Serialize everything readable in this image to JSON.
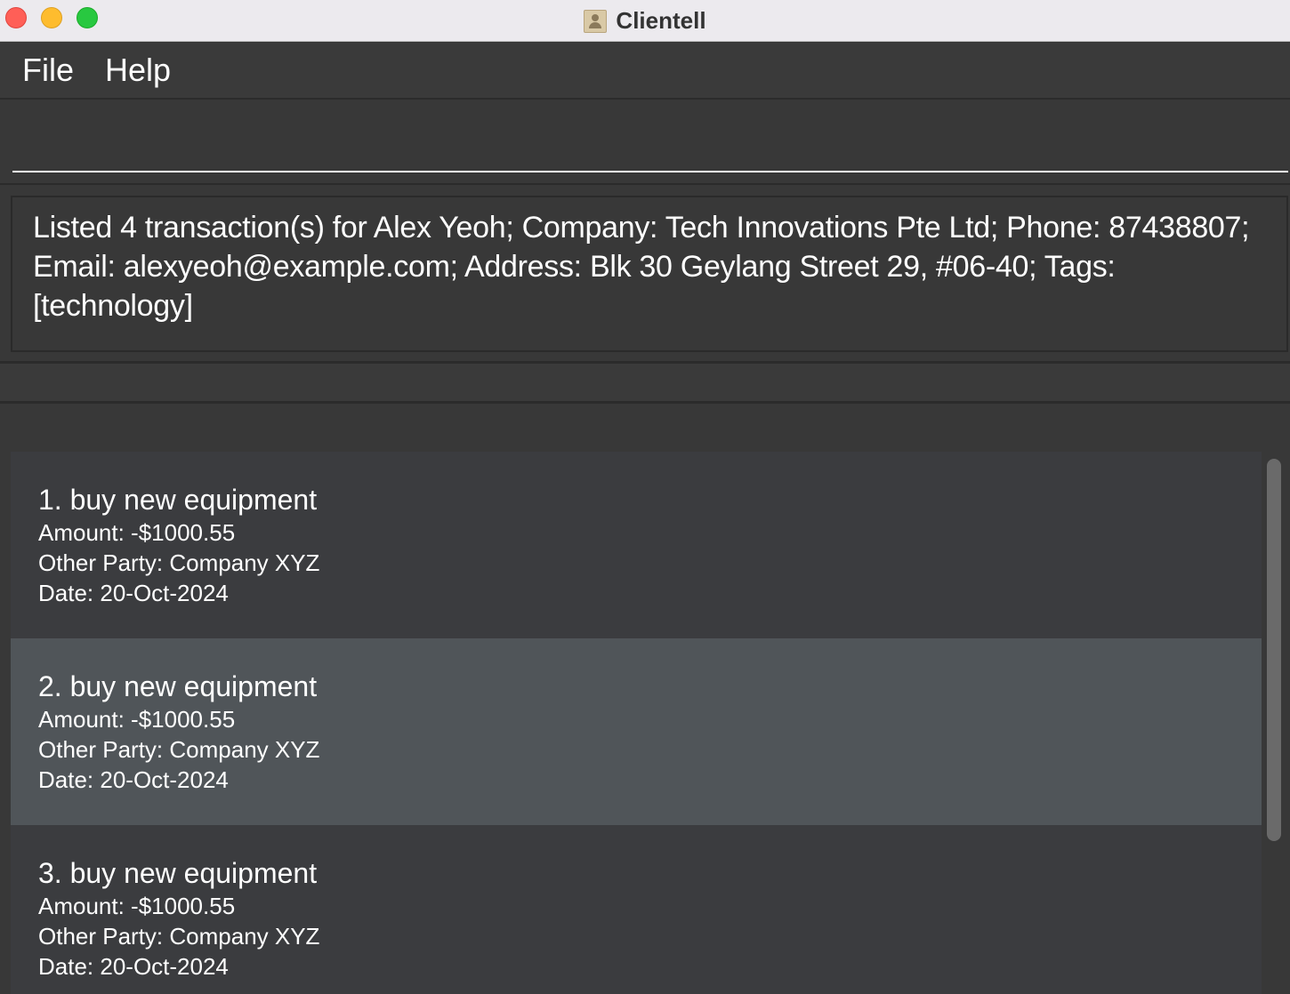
{
  "window": {
    "title": "Clientell"
  },
  "menu": {
    "file": "File",
    "help": "Help"
  },
  "command": {
    "value": "",
    "placeholder": ""
  },
  "result": {
    "message": "Listed 4 transaction(s) for Alex Yeoh; Company: Tech Innovations Pte Ltd; Phone: 87438807; Email: alexyeoh@example.com; Address: Blk 30 Geylang Street 29, #06-40; Tags: [technology]"
  },
  "transactions": [
    {
      "title": "1. buy new equipment",
      "amount": "Amount: -$1000.55",
      "other_party": "Other Party: Company XYZ",
      "date": "Date: 20-Oct-2024"
    },
    {
      "title": "2. buy new equipment",
      "amount": "Amount: -$1000.55",
      "other_party": "Other Party: Company XYZ",
      "date": "Date: 20-Oct-2024"
    },
    {
      "title": "3. buy new equipment",
      "amount": "Amount: -$1000.55",
      "other_party": "Other Party: Company XYZ",
      "date": "Date: 20-Oct-2024"
    }
  ],
  "colors": {
    "background": "#383838",
    "selected_row": "#505559",
    "row": "#3b3c3f"
  }
}
